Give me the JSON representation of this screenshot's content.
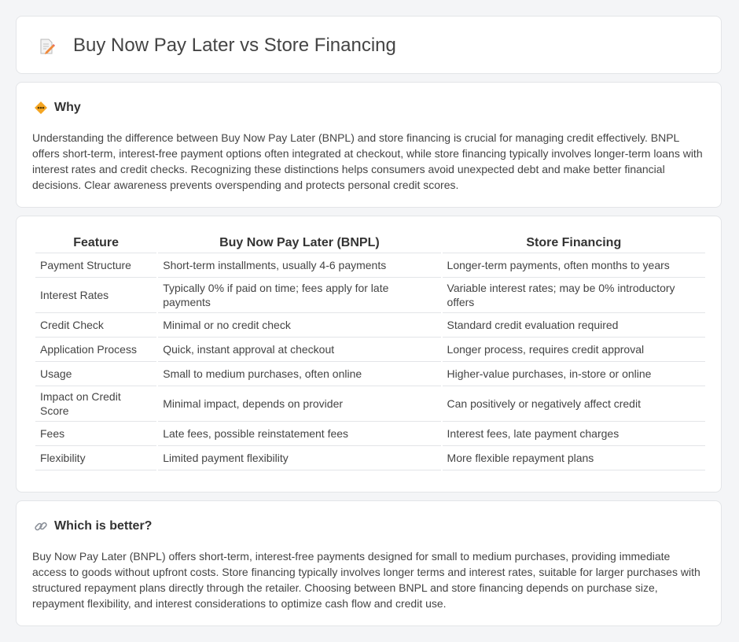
{
  "header": {
    "title": "Buy Now Pay Later vs Store Financing",
    "icon": "document-pencil-icon"
  },
  "why": {
    "title": "Why",
    "icon": "diamond-warning-icon",
    "text": "Understanding the difference between Buy Now Pay Later (BNPL) and store financing is crucial for managing credit effectively. BNPL offers short-term, interest-free payment options often integrated at checkout, while store financing typically involves longer-term loans with interest rates and credit checks. Recognizing these distinctions helps consumers avoid unexpected debt and make better financial decisions. Clear awareness prevents overspending and protects personal credit scores."
  },
  "table": {
    "headers": [
      "Feature",
      "Buy Now Pay Later (BNPL)",
      "Store Financing"
    ],
    "rows": [
      [
        "Payment Structure",
        "Short-term installments, usually 4-6 payments",
        "Longer-term payments, often months to years"
      ],
      [
        "Interest Rates",
        "Typically 0% if paid on time; fees apply for late payments",
        "Variable interest rates; may be 0% introductory offers"
      ],
      [
        "Credit Check",
        "Minimal or no credit check",
        "Standard credit evaluation required"
      ],
      [
        "Application Process",
        "Quick, instant approval at checkout",
        "Longer process, requires credit approval"
      ],
      [
        "Usage",
        "Small to medium purchases, often online",
        "Higher-value purchases, in-store or online"
      ],
      [
        "Impact on Credit Score",
        "Minimal impact, depends on provider",
        "Can positively or negatively affect credit"
      ],
      [
        "Fees",
        "Late fees, possible reinstatement fees",
        "Interest fees, late payment charges"
      ],
      [
        "Flexibility",
        "Limited payment flexibility",
        "More flexible repayment plans"
      ]
    ]
  },
  "better": {
    "title": "Which is better?",
    "icon": "link-icon",
    "text": "Buy Now Pay Later (BNPL) offers short-term, interest-free payments designed for small to medium purchases, providing immediate access to goods without upfront costs. Store financing typically involves longer terms and interest rates, suitable for larger purchases with structured repayment plans directly through the retailer. Choosing between BNPL and store financing depends on purchase size, repayment flexibility, and interest considerations to optimize cash flow and credit use."
  }
}
